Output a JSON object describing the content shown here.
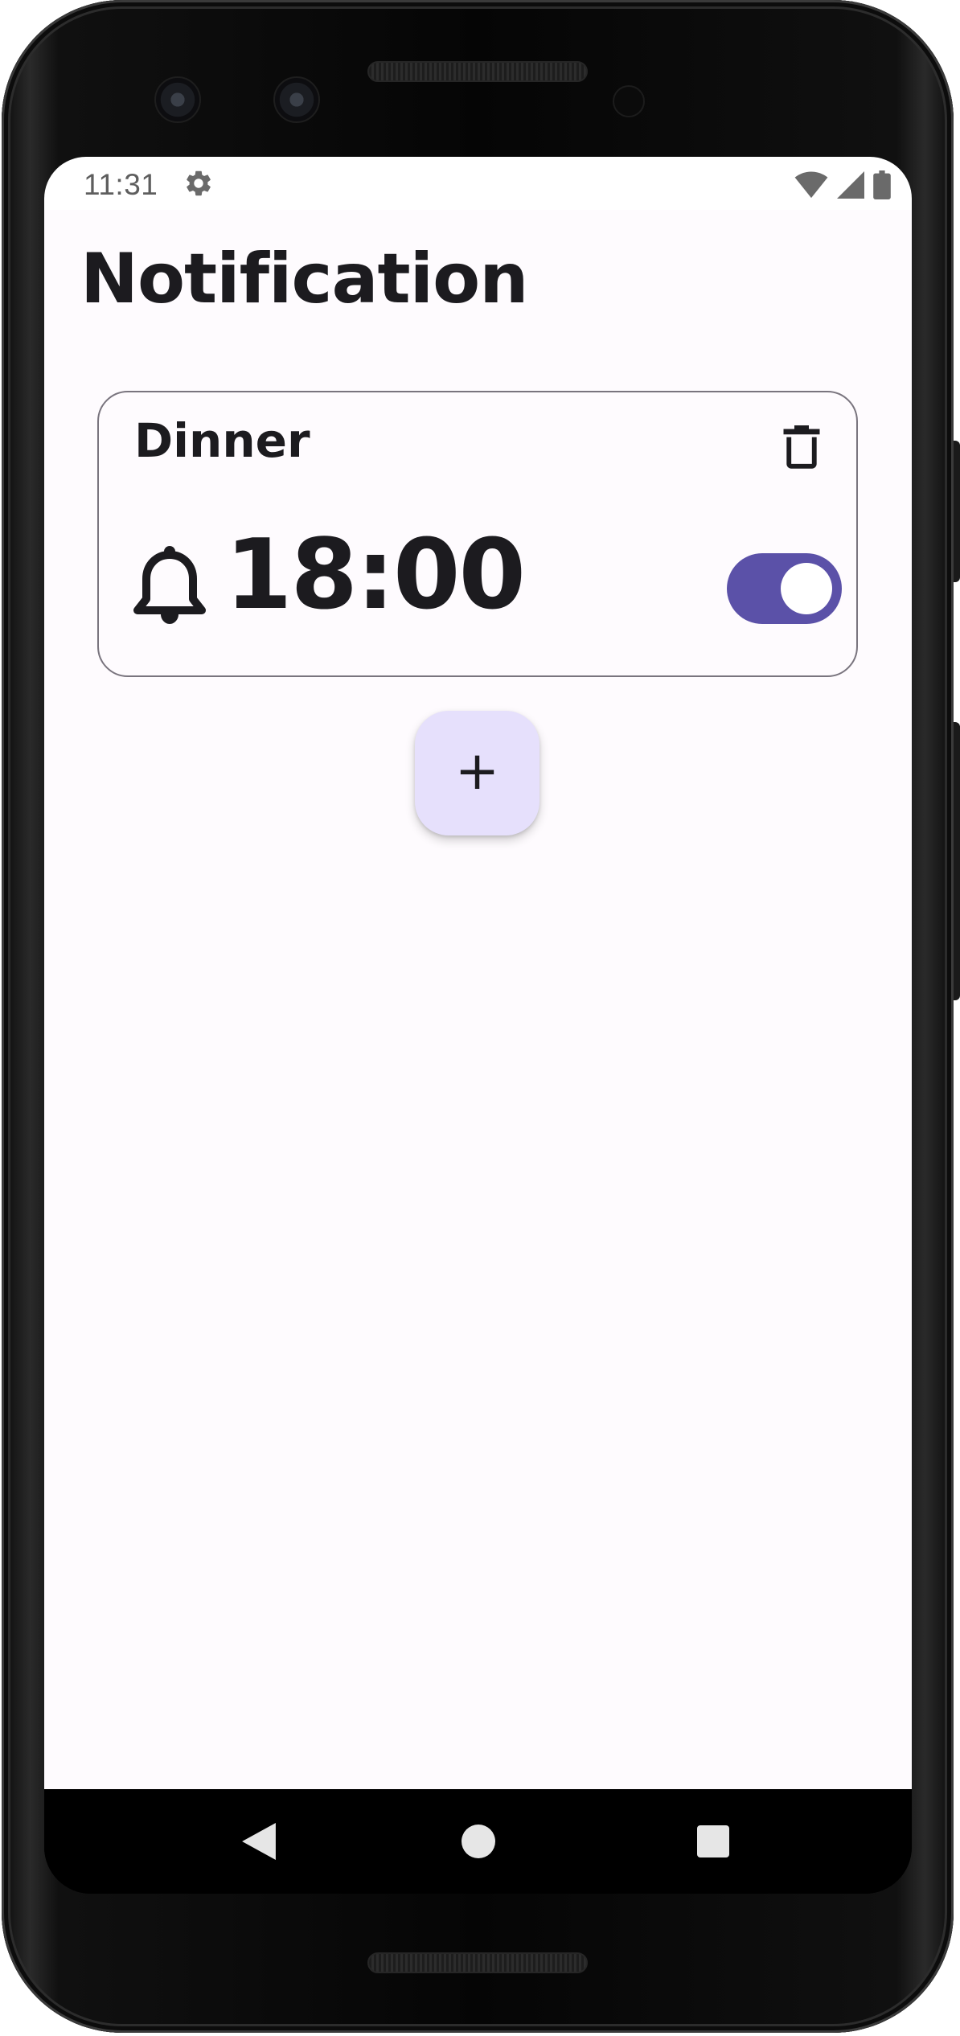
{
  "status_bar": {
    "time": "11:31",
    "icons": [
      "settings-gear-icon",
      "wifi-icon",
      "cellular-signal-icon",
      "battery-icon"
    ]
  },
  "page": {
    "title": "Notification"
  },
  "notifications": [
    {
      "name": "Dinner",
      "time": "18:00",
      "enabled": true,
      "icon": "bell-icon",
      "delete_icon": "trash-icon"
    }
  ],
  "fab": {
    "label": "+"
  },
  "navigation": {
    "buttons": [
      "back-icon",
      "home-icon",
      "recents-icon"
    ]
  },
  "colors": {
    "background": "#fefbfe",
    "text": "#1c1b1f",
    "outline": "#79747e",
    "toggle_on": "#5b51a8",
    "fab": "#e6e0fc",
    "status_text": "#5e5e5e"
  }
}
